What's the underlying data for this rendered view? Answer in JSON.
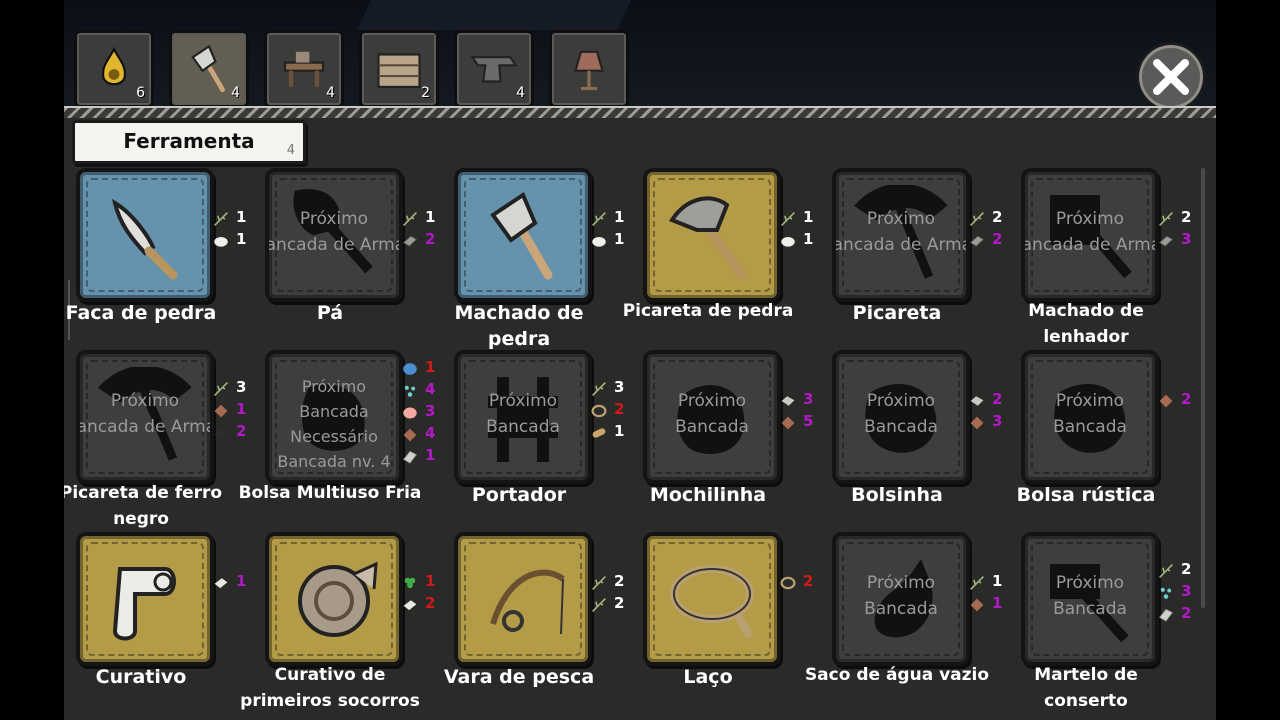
{
  "category_tabs": [
    {
      "icon": "oil-lamp-icon",
      "count": "6"
    },
    {
      "icon": "stone-axe-icon",
      "count": "4"
    },
    {
      "icon": "workbench-icon",
      "count": "4"
    },
    {
      "icon": "wooden-crate-icon",
      "count": "2"
    },
    {
      "icon": "anvil-icon",
      "count": "4"
    },
    {
      "icon": "armor-stand-icon",
      "count": ""
    }
  ],
  "section": {
    "label": "Ferramenta",
    "count": "4"
  },
  "colors": {
    "blue_card": "#6592ac",
    "gold_card": "#b39b47",
    "locked_card": "#3e3e3d",
    "red": "#d11a1a",
    "purple": "#b318c8"
  },
  "items": [
    {
      "name": "Faca de pedra",
      "state": "blue",
      "icon": "stone-knife-icon",
      "lock": [],
      "reqs": [
        {
          "icon": "twig-icon",
          "qty": "1",
          "color": "white"
        },
        {
          "icon": "stone-icon",
          "qty": "1",
          "color": "white"
        }
      ]
    },
    {
      "name": "Pá",
      "state": "locked",
      "icon": "shovel-silhouette-icon",
      "lock": [
        "Próximo",
        "Bancada de Armas"
      ],
      "reqs": [
        {
          "icon": "twig-icon",
          "qty": "1",
          "color": "white"
        },
        {
          "icon": "iron-ingot-icon",
          "qty": "2",
          "color": "purple"
        }
      ]
    },
    {
      "name": "Machado de pedra",
      "state": "blue",
      "icon": "stone-axe-icon",
      "lock": [],
      "reqs": [
        {
          "icon": "twig-icon",
          "qty": "1",
          "color": "white"
        },
        {
          "icon": "stone-icon",
          "qty": "1",
          "color": "white"
        }
      ]
    },
    {
      "name": "Picareta de pedra",
      "state": "gold",
      "icon": "stone-pickaxe-icon",
      "lock": [],
      "reqs": [
        {
          "icon": "twig-icon",
          "qty": "1",
          "color": "white"
        },
        {
          "icon": "stone-icon",
          "qty": "1",
          "color": "white"
        }
      ]
    },
    {
      "name": "Picareta",
      "state": "locked",
      "icon": "pickaxe-silhouette-icon",
      "lock": [
        "Próximo",
        "Bancada de Armas"
      ],
      "reqs": [
        {
          "icon": "twig-icon",
          "qty": "2",
          "color": "white"
        },
        {
          "icon": "iron-ingot-icon",
          "qty": "2",
          "color": "purple"
        }
      ]
    },
    {
      "name": "Machado de lenhador",
      "state": "locked",
      "icon": "axe-silhouette-icon",
      "lock": [
        "Próximo",
        "Bancada de Armas"
      ],
      "reqs": [
        {
          "icon": "twig-icon",
          "qty": "2",
          "color": "white"
        },
        {
          "icon": "iron-ingot-icon",
          "qty": "3",
          "color": "purple"
        }
      ]
    },
    {
      "name": "Picareta de ferro negro",
      "state": "locked",
      "icon": "pickaxe-silhouette-icon",
      "lock": [
        "Próximo",
        "Bancada de Armas"
      ],
      "reqs": [
        {
          "icon": "twig-icon",
          "qty": "3",
          "color": "white"
        },
        {
          "icon": "leather-icon",
          "qty": "1",
          "color": "purple"
        },
        {
          "icon": "black-iron-icon",
          "qty": "2",
          "color": "purple"
        }
      ]
    },
    {
      "name": "Bolsa Multiuso Fria",
      "state": "locked",
      "icon": "bag-silhouette-icon",
      "lock": [
        "Próximo",
        "Bancada",
        "Necessário",
        "Bancada nv. 4"
      ],
      "reqs": [
        {
          "icon": "blue-gem-icon",
          "qty": "1",
          "color": "red"
        },
        {
          "icon": "crystal-shards-icon",
          "qty": "4",
          "color": "purple"
        },
        {
          "icon": "pink-meat-icon",
          "qty": "3",
          "color": "purple"
        },
        {
          "icon": "leather-icon",
          "qty": "4",
          "color": "purple"
        },
        {
          "icon": "steel-ingot-icon",
          "qty": "1",
          "color": "purple"
        }
      ]
    },
    {
      "name": "Portador",
      "state": "locked",
      "icon": "frame-silhouette-icon",
      "lock": [
        "Próximo",
        "Bancada"
      ],
      "reqs": [
        {
          "icon": "twig-icon",
          "qty": "3",
          "color": "white"
        },
        {
          "icon": "rope-icon",
          "qty": "2",
          "color": "red"
        },
        {
          "icon": "log-icon",
          "qty": "1",
          "color": "white"
        }
      ]
    },
    {
      "name": "Mochilinha",
      "state": "locked",
      "icon": "backpack-silhouette-icon",
      "lock": [
        "Próximo",
        "Bancada"
      ],
      "reqs": [
        {
          "icon": "fur-icon",
          "qty": "3",
          "color": "purple"
        },
        {
          "icon": "leather-icon",
          "qty": "5",
          "color": "purple"
        }
      ]
    },
    {
      "name": "Bolsinha",
      "state": "locked",
      "icon": "pouch-silhouette-icon",
      "lock": [
        "Próximo",
        "Bancada"
      ],
      "reqs": [
        {
          "icon": "fur-icon",
          "qty": "2",
          "color": "purple"
        },
        {
          "icon": "leather-icon",
          "qty": "3",
          "color": "purple"
        }
      ]
    },
    {
      "name": "Bolsa rústica",
      "state": "locked",
      "icon": "pouch-silhouette-icon",
      "lock": [
        "Próximo",
        "Bancada"
      ],
      "reqs": [
        {
          "icon": "leather-icon",
          "qty": "2",
          "color": "purple"
        }
      ]
    },
    {
      "name": "Curativo",
      "state": "gold",
      "icon": "bandage-icon",
      "lock": [],
      "reqs": [
        {
          "icon": "cloth-icon",
          "qty": "1",
          "color": "purple"
        }
      ]
    },
    {
      "name": "Curativo de primeiros socorros",
      "state": "gold",
      "icon": "bandage-roll-icon",
      "lock": [],
      "reqs": [
        {
          "icon": "herb-icon",
          "qty": "1",
          "color": "red"
        },
        {
          "icon": "cloth-icon",
          "qty": "2",
          "color": "red"
        }
      ]
    },
    {
      "name": "Vara de pesca",
      "state": "gold",
      "icon": "fishing-rod-icon",
      "lock": [],
      "reqs": [
        {
          "icon": "twig-icon",
          "qty": "2",
          "color": "white"
        },
        {
          "icon": "twig-icon",
          "qty": "2",
          "color": "white"
        }
      ]
    },
    {
      "name": "Laço",
      "state": "gold",
      "icon": "lasso-icon",
      "lock": [],
      "reqs": [
        {
          "icon": "rope-icon",
          "qty": "2",
          "color": "red"
        }
      ]
    },
    {
      "name": "Saco de água vazio",
      "state": "locked",
      "icon": "waterskin-silhouette-icon",
      "lock": [
        "Próximo",
        "Bancada"
      ],
      "reqs": [
        {
          "icon": "twig-icon",
          "qty": "1",
          "color": "white"
        },
        {
          "icon": "leather-icon",
          "qty": "1",
          "color": "purple"
        }
      ]
    },
    {
      "name": "Martelo de conserto",
      "state": "locked",
      "icon": "hammer-silhouette-icon",
      "lock": [
        "Próximo",
        "Bancada"
      ],
      "reqs": [
        {
          "icon": "twig-icon",
          "qty": "2",
          "color": "white"
        },
        {
          "icon": "crystal-shards-icon",
          "qty": "3",
          "color": "purple"
        },
        {
          "icon": "steel-ingot-icon",
          "qty": "2",
          "color": "purple"
        }
      ]
    }
  ]
}
